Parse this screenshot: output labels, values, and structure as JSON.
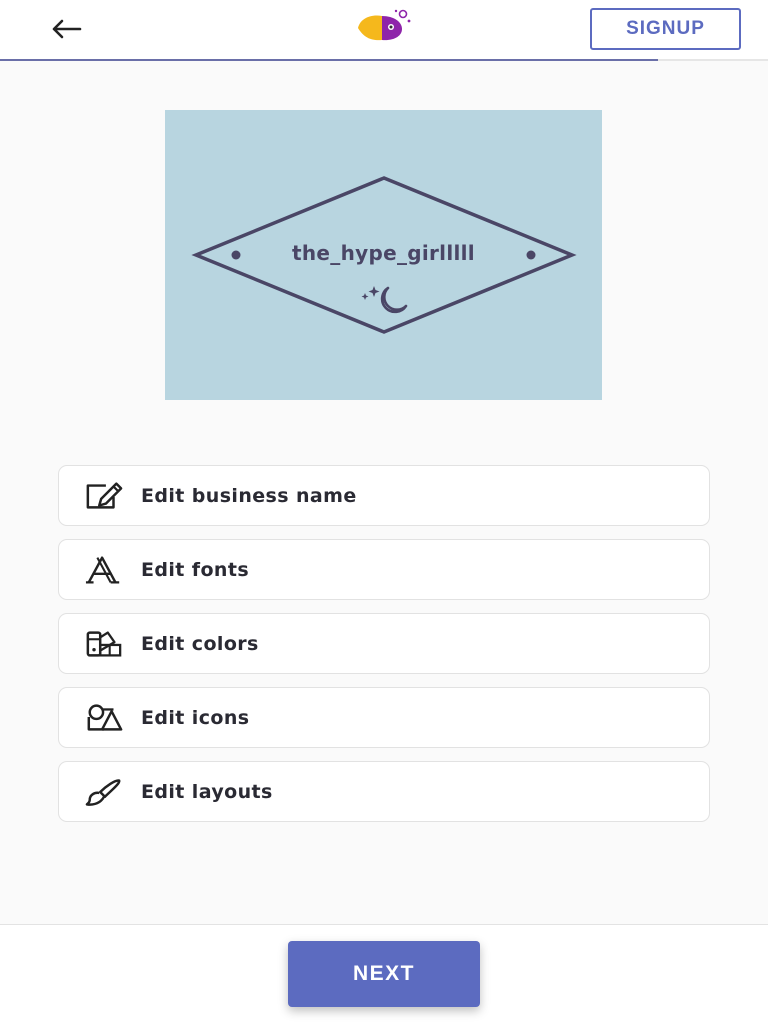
{
  "header": {
    "back_icon": "arrow-left-icon",
    "logo_icon": "parrot-logo-icon",
    "signup_label": "SIGNUP",
    "progress_fraction": 0.857
  },
  "preview": {
    "business_name": "the_hype_girlllll",
    "background_color": "#b8d5e0",
    "line_color": "#4a4666",
    "symbol_icon": "moon-stars-icon"
  },
  "options": [
    {
      "label": "Edit business name",
      "icon": "edit-pencil-icon"
    },
    {
      "label": "Edit fonts",
      "icon": "font-icon"
    },
    {
      "label": "Edit colors",
      "icon": "color-swatch-icon"
    },
    {
      "label": "Edit icons",
      "icon": "shapes-icon"
    },
    {
      "label": "Edit layouts",
      "icon": "brush-icon"
    }
  ],
  "footer": {
    "next_label": "NEXT"
  },
  "colors": {
    "accent": "#5c6bc0",
    "background": "#fafafa"
  }
}
